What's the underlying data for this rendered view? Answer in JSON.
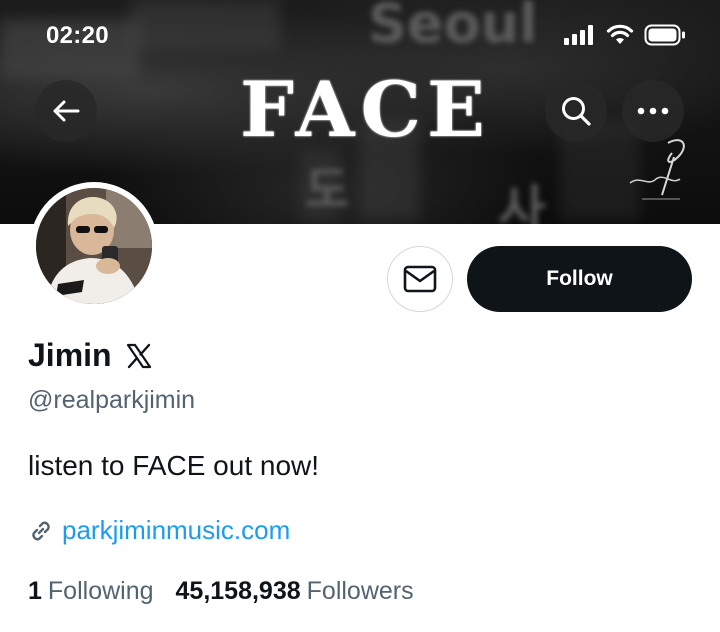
{
  "status_bar": {
    "time": "02:20"
  },
  "banner": {
    "title": "FACE",
    "bg_words": [
      "Seoul",
      "도",
      "사"
    ]
  },
  "profile": {
    "display_name": "Jimin",
    "handle": "@realparkjimin",
    "bio": "listen to FACE out now!",
    "link": "parkjiminmusic.com",
    "following_count": "1",
    "following_label": "Following",
    "followers_count": "45,158,938",
    "followers_label": "Followers"
  },
  "actions": {
    "follow_label": "Follow"
  },
  "colors": {
    "link": "#1d9bf0",
    "secondary_text": "#536471",
    "follow_button_bg": "#0f1419"
  },
  "icons": [
    "back-arrow-icon",
    "search-icon",
    "more-icon",
    "message-icon",
    "x-logo-icon",
    "link-icon",
    "signal-icon",
    "wifi-icon",
    "battery-icon"
  ]
}
